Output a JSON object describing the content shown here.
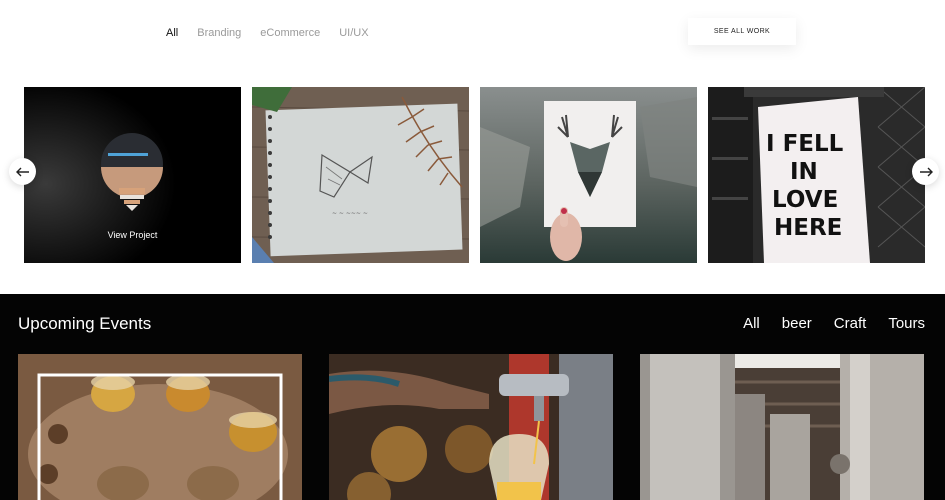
{
  "portfolio": {
    "filters": [
      {
        "label": "All",
        "active": true
      },
      {
        "label": "Branding",
        "active": false
      },
      {
        "label": "eCommerce",
        "active": false
      },
      {
        "label": "UI/UX",
        "active": false
      }
    ],
    "see_all_label": "SEE ALL WORK",
    "view_project_label": "View Project",
    "sign_text": [
      "I FELL",
      "IN",
      "LOVE",
      "HERE"
    ],
    "prev_icon": "arrow-left-icon",
    "next_icon": "arrow-right-icon"
  },
  "events": {
    "title": "Upcoming Events",
    "filters": [
      "All",
      "beer",
      "Craft",
      "Tours"
    ]
  }
}
